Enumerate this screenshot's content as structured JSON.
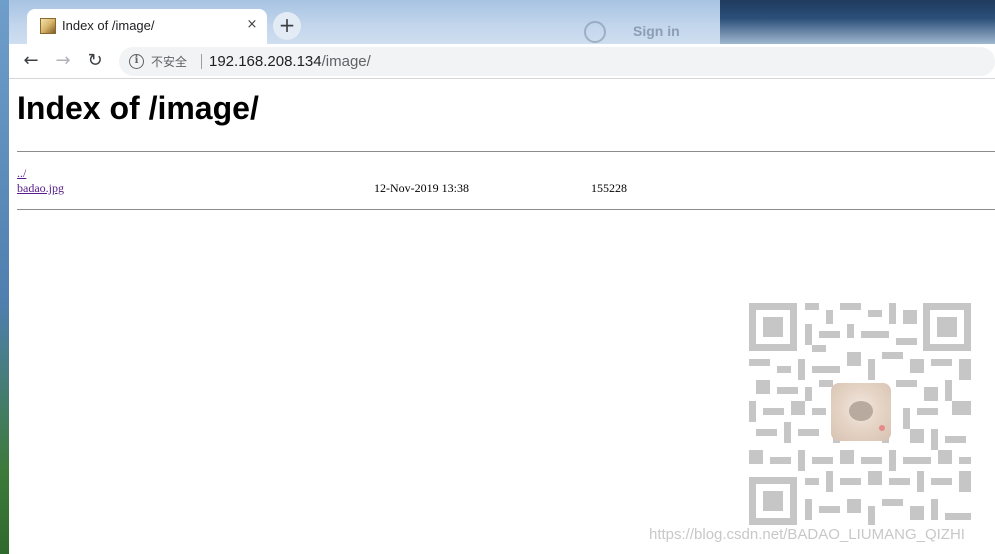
{
  "browser": {
    "tab": {
      "title": "Index of /image/",
      "close_icon": "×"
    },
    "new_tab_icon": "+",
    "sign_in_label": "Sign in",
    "nav": {
      "back_icon": "←",
      "forward_icon": "→",
      "reload_icon": "↻"
    },
    "omnibox": {
      "info_icon": "i",
      "security_label": "不安全",
      "url_host": "192.168.208.134",
      "url_path": "/image/"
    }
  },
  "page": {
    "heading": "Index of /image/",
    "entries": [
      {
        "name": "../",
        "date": "",
        "size": ""
      },
      {
        "name": "badao.jpg",
        "date": "12-Nov-2019 13:38",
        "size": "155228"
      }
    ]
  },
  "watermark": {
    "text": "https://blog.csdn.net/BADAO_LIUMANG_QIZHI"
  },
  "colors": {
    "link": "#551a8b",
    "rule": "#8c8c8c",
    "qr": "#c6c6c6"
  }
}
